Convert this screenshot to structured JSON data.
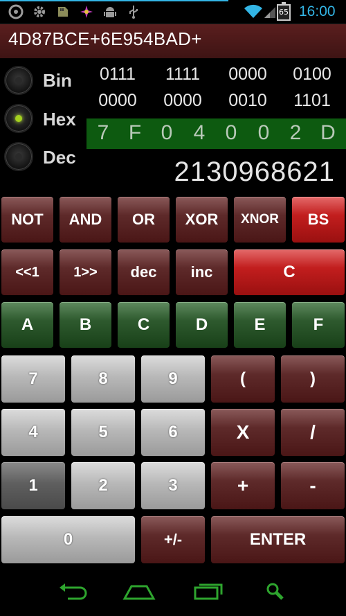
{
  "status_bar": {
    "icons_left": [
      "circle-app-icon",
      "gear-icon",
      "sd-card-icon",
      "pinwheel-icon",
      "android-icon",
      "usb-icon"
    ],
    "icons_right": [
      "wifi-icon",
      "signal-icon",
      "battery-icon"
    ],
    "battery_level": "65",
    "time": "16:00",
    "accent_color": "#33b5e5"
  },
  "expression": "4D87BCE+6E954BAD+",
  "modes": [
    {
      "label": "Bin",
      "selected": false
    },
    {
      "label": "Hex",
      "selected": true
    },
    {
      "label": "Dec",
      "selected": false
    }
  ],
  "binary": {
    "row1": [
      "0111",
      "1111",
      "0000",
      "0100"
    ],
    "row2": [
      "0000",
      "0000",
      "0010",
      "1101"
    ]
  },
  "hex_digits": [
    "7",
    "F",
    "0",
    "4",
    "0",
    "0",
    "2",
    "D"
  ],
  "decimal_value": "2130968621",
  "keys": {
    "row1": [
      "NOT",
      "AND",
      "OR",
      "XOR",
      "XNOR",
      "BS"
    ],
    "row2": [
      "<<1",
      "1>>",
      "dec",
      "inc",
      "C"
    ],
    "row3": [
      "A",
      "B",
      "C",
      "D",
      "E",
      "F"
    ],
    "row4": [
      "7",
      "8",
      "9",
      "(",
      ")"
    ],
    "row5": [
      "4",
      "5",
      "6",
      "X",
      "/"
    ],
    "row6": [
      "1",
      "2",
      "3",
      "+",
      "-"
    ],
    "row7": [
      "0",
      "+/-",
      "ENTER"
    ]
  },
  "nav": [
    "back-icon",
    "home-icon",
    "recent-apps-icon",
    "search-icon"
  ],
  "colors": {
    "brown_key": "#5e2a2a",
    "red_key": "#c21e1e",
    "green_key": "#2e5a2e",
    "grey_key": "#b8b8b8",
    "hex_display_bg": "#0d5a10",
    "radio_selected": "#a5d21f",
    "nav_icon": "#2ea52e"
  }
}
